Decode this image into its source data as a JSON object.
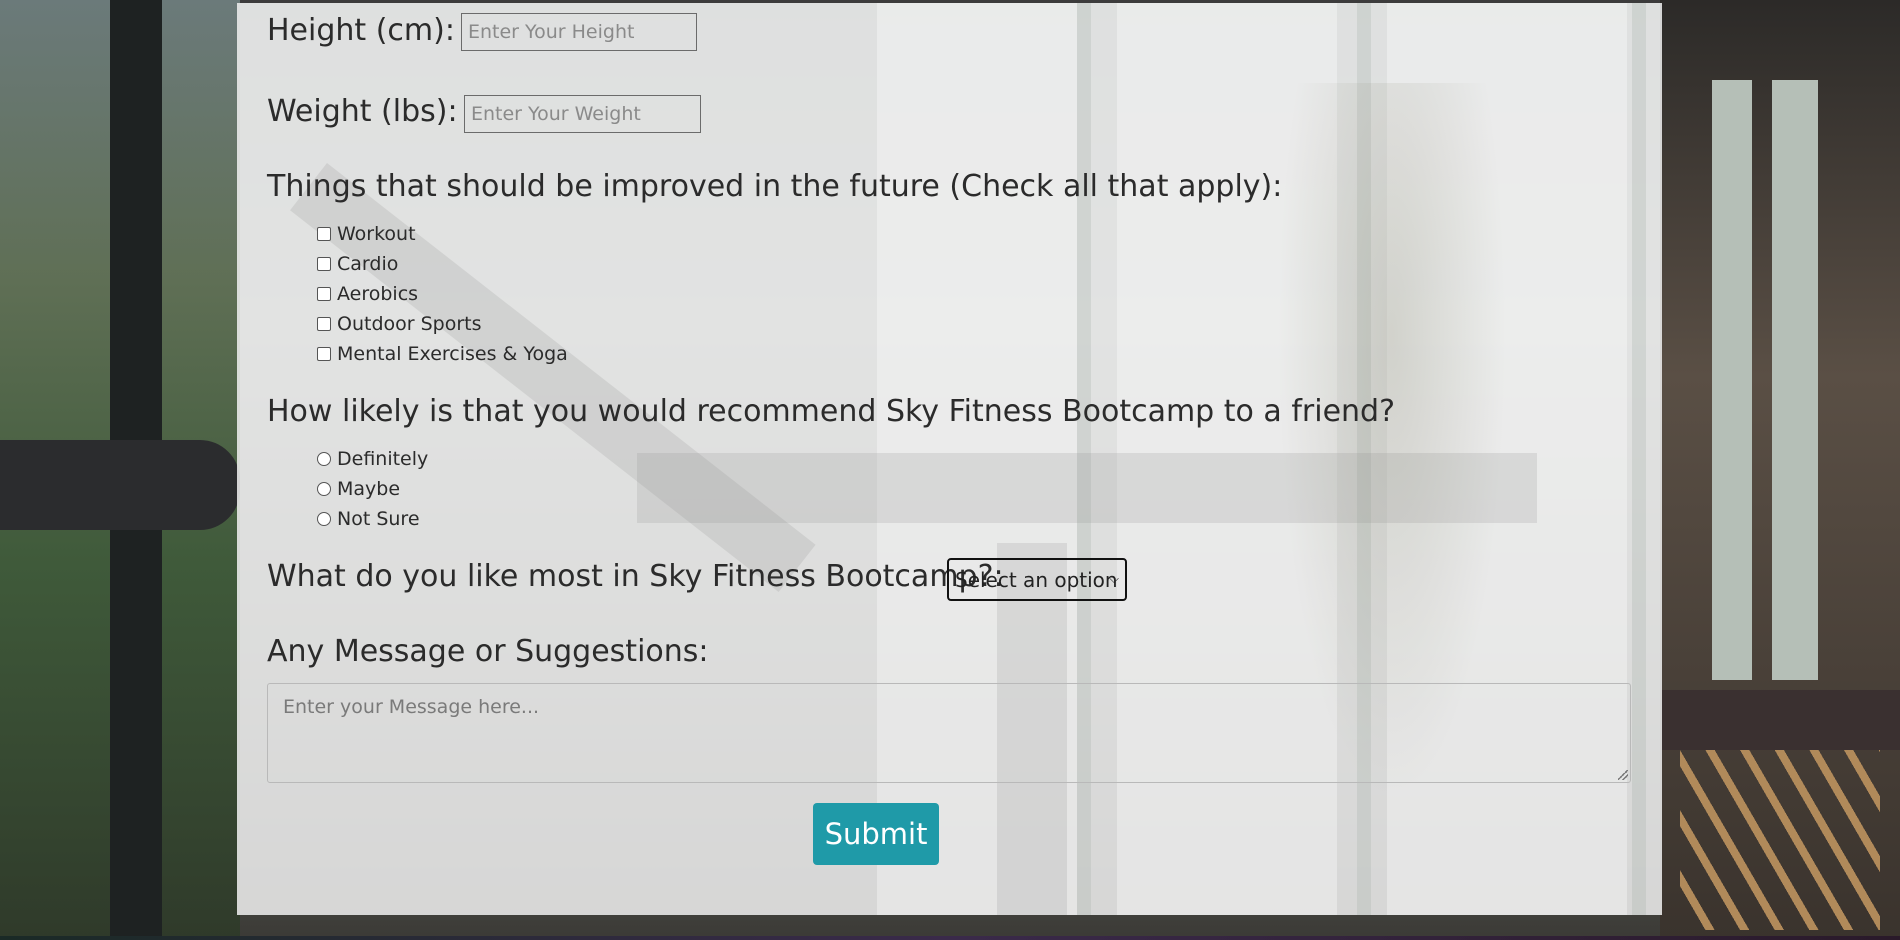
{
  "form": {
    "height": {
      "label": "Height (cm):",
      "placeholder": "Enter Your Height"
    },
    "weight": {
      "label": "Weight (lbs):",
      "placeholder": "Enter Your Weight"
    },
    "improve": {
      "label": "Things that should be improved in the future (Check all that apply):",
      "options": [
        "Workout",
        "Cardio",
        "Aerobics",
        "Outdoor Sports",
        "Mental Exercises & Yoga"
      ]
    },
    "recommend": {
      "label": "How likely is that you would recommend Sky Fitness Bootcamp to a friend?",
      "options": [
        "Definitely",
        "Maybe",
        "Not Sure"
      ]
    },
    "like_most": {
      "label": "What do you like most in Sky Fitness Bootcamp?:",
      "selected": "Select an option"
    },
    "message": {
      "label": "Any Message or Suggestions:",
      "placeholder": "Enter your Message here..."
    },
    "submit_label": "Submit"
  },
  "colors": {
    "submit_bg": "#1f9aa8",
    "panel_bg": "#ececec"
  }
}
